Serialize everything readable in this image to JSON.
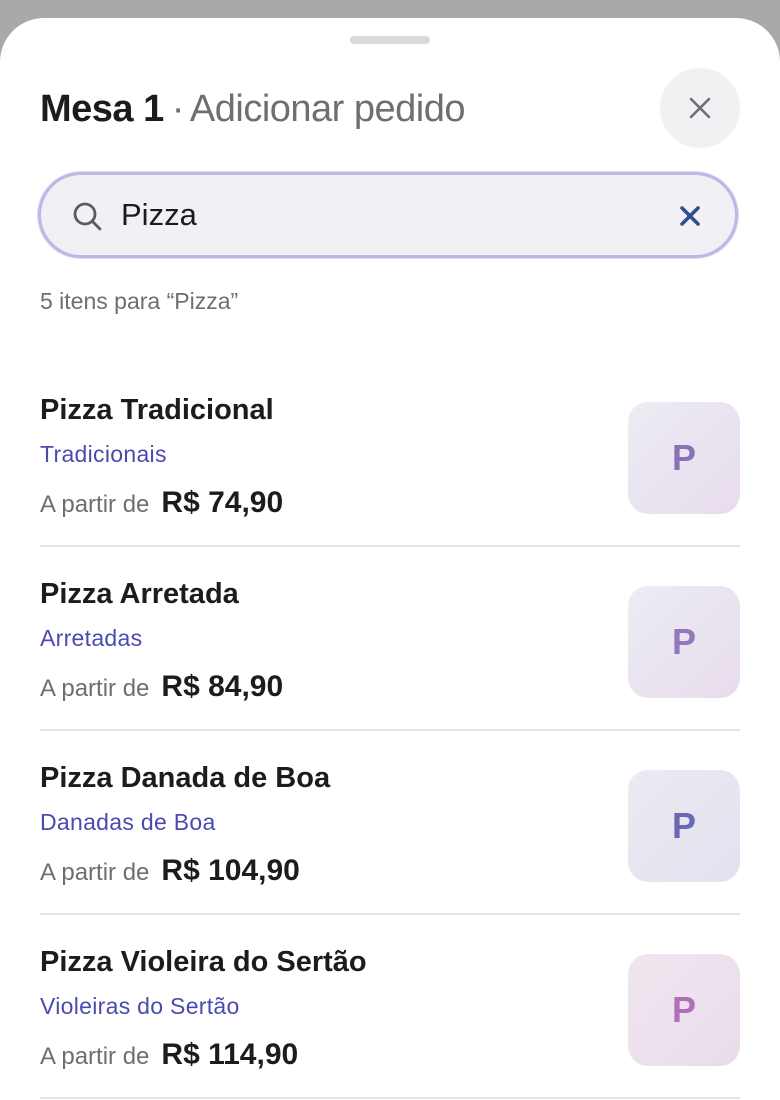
{
  "header": {
    "title": "Mesa 1",
    "separator": "·",
    "subtitle": "Adicionar pedido"
  },
  "close_button": {
    "icon": "close-icon"
  },
  "search": {
    "icon": "search-icon",
    "value": "Pizza",
    "clear_icon": "clear-icon"
  },
  "result_count": "5 itens para “Pizza”",
  "items": [
    {
      "name": "Pizza Tradicional",
      "category": "Tradicionais",
      "price_prefix": "A partir de",
      "price": "R$ 74,90",
      "thumb_letter": "P"
    },
    {
      "name": "Pizza Arretada",
      "category": "Arretadas",
      "price_prefix": "A partir de",
      "price": "R$ 84,90",
      "thumb_letter": "P"
    },
    {
      "name": "Pizza Danada de Boa",
      "category": "Danadas de Boa",
      "price_prefix": "A partir de",
      "price": "R$ 104,90",
      "thumb_letter": "P"
    },
    {
      "name": "Pizza Violeira do Sertão",
      "category": "Violeiras do Sertão",
      "price_prefix": "A partir de",
      "price": "R$ 114,90",
      "thumb_letter": "P"
    }
  ],
  "colors": {
    "accent": "#4a4ab0",
    "clear_icon": "#2f4f8f",
    "thumb_letters": [
      "#8a72b8",
      "#9378ba",
      "#6a68b0",
      "#b070b8"
    ],
    "thumb_backgrounds": [
      "#ebe4ef",
      "#ebe3ee",
      "#e6e4f0",
      "#eee3ed"
    ]
  }
}
